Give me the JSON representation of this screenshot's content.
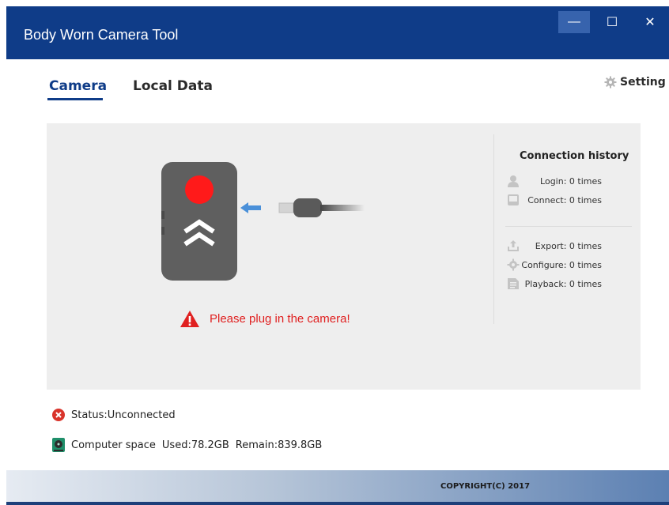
{
  "window": {
    "title": "Body Worn Camera Tool",
    "minimize_glyph": "—",
    "maximize_glyph": "☐",
    "close_glyph": "✕"
  },
  "tabs": [
    {
      "label": "Camera",
      "active": true
    },
    {
      "label": "Local Data",
      "active": false
    }
  ],
  "setting": {
    "label": "Setting",
    "icon": "gear-icon"
  },
  "panel": {
    "warning": {
      "text": "Please plug in the camera!",
      "icon": "warning-icon",
      "color": "#e02020"
    },
    "history": {
      "title": "Connection history",
      "rows": [
        {
          "label": "Login: 0 times",
          "icon": "user-icon"
        },
        {
          "label": "Connect: 0 times",
          "icon": "inbox-icon"
        },
        {
          "label": "Export: 0 times",
          "icon": "export-icon"
        },
        {
          "label": "Configure: 0 times",
          "icon": "gear-icon"
        },
        {
          "label": "Playback: 0 times",
          "icon": "playback-icon"
        }
      ]
    }
  },
  "status": {
    "connection": "Status:Unconnected",
    "computer_space_label": "Computer space",
    "used": "Used:78.2GB",
    "remain": "Remain:839.8GB"
  },
  "footer": {
    "copyright": "COPYRIGHT(C) 2017"
  },
  "colors": {
    "title_bar": "#0f3c88",
    "accent": "#0f3c88",
    "error": "#e02020"
  }
}
